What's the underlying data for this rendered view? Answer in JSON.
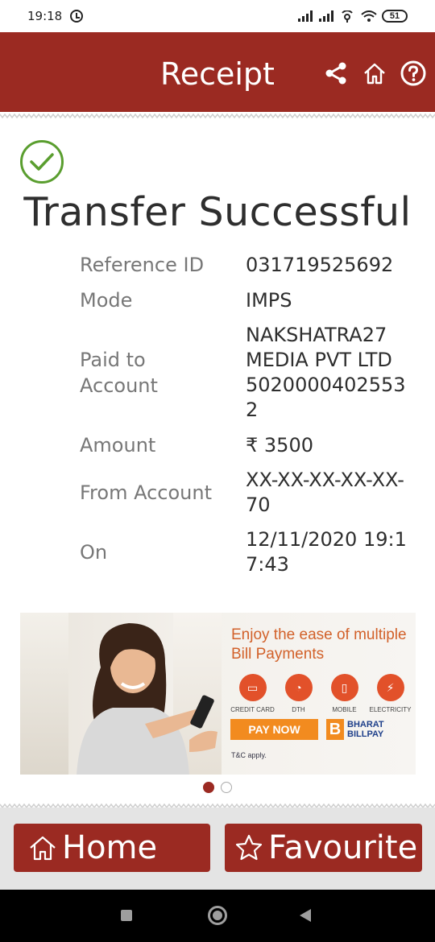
{
  "status": {
    "time": "19:18",
    "battery": "51"
  },
  "header": {
    "title": "Receipt"
  },
  "success": {
    "title": "Transfer Successful"
  },
  "details": [
    {
      "label": "Reference ID",
      "value": "031719525692"
    },
    {
      "label": "Mode",
      "value": "IMPS"
    },
    {
      "label": "Paid to Account",
      "value": "NAKSHATRA27 MEDIA PVT LTD 50200004025532"
    },
    {
      "label": "Amount",
      "value": "₹ 3500"
    },
    {
      "label": "From Account",
      "value": "XX-XX-XX-XX-XX-70"
    },
    {
      "label": "On",
      "value": "12/11/2020 19:17:43"
    }
  ],
  "banner": {
    "headline": "Enjoy the ease of multiple Bill Payments",
    "categories": [
      "CREDIT CARD",
      "DTH",
      "MOBILE",
      "ELECTRICITY"
    ],
    "pay_now": "PAY NOW",
    "brand_line1": "BHARAT",
    "brand_line2": "BILLPAY",
    "brand_letter": "B",
    "terms": "T&C apply.",
    "slide_count": 2,
    "active_slide": 1
  },
  "buttons": {
    "home": "Home",
    "favourite": "Favourite"
  },
  "colors": {
    "brand": "#9b2a22",
    "success_green": "#5a9e2f",
    "banner_orange": "#e2512a"
  }
}
